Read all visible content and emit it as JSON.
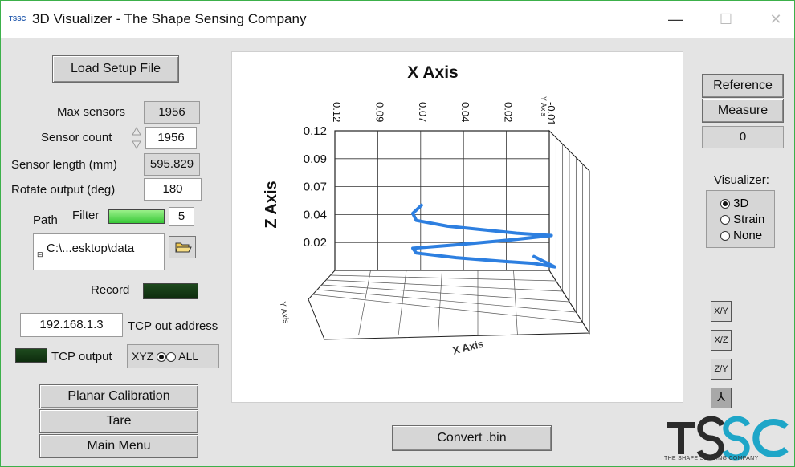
{
  "window": {
    "app_icon": "TSSC",
    "title": "3D Visualizer - The Shape Sensing Company",
    "minimize": "—",
    "maximize": "☐",
    "close": "✕"
  },
  "left": {
    "load_setup_label": "Load Setup File",
    "max_sensors_label": "Max sensors",
    "max_sensors_value": "1956",
    "sensor_count_label": "Sensor count",
    "sensor_count_value": "1956",
    "sensor_length_label": "Sensor length (mm)",
    "sensor_length_value": "595.829",
    "rotate_label": "Rotate output (deg)",
    "rotate_value": "180",
    "path_label": "Path",
    "filter_label": "Filter",
    "filter_value": "5",
    "path_value": "C:\\...esktop\\data",
    "record_label": "Record",
    "tcp_address_value": "192.168.1.3",
    "tcp_address_label": "TCP out address",
    "tcp_output_label": "TCP output",
    "xyz_label": "XYZ",
    "all_label": "ALL",
    "planar_calibration_label": "Planar Calibration",
    "tare_label": "Tare",
    "main_menu_label": "Main Menu"
  },
  "center": {
    "convert_label": "Convert .bin"
  },
  "right": {
    "reference_label": "Reference",
    "measure_label": "Measure",
    "measure_value": "0",
    "visualizer_label": "Visualizer:",
    "opt_3d": "3D",
    "opt_strain": "Strain",
    "opt_none": "None",
    "selected": "3D",
    "tool_icons": [
      "xy-plane-icon",
      "xz-plane-icon",
      "yz-plane-icon",
      "axes-3d-icon"
    ],
    "tool_xy": "X/Y",
    "tool_xz": "X/Z",
    "tool_yz": "Z/Y",
    "tool_3d": "⅄"
  },
  "logo": {
    "mark": "TSSC",
    "tagline": "THE SHAPE SENSING COMPANY"
  },
  "colors": {
    "accent_border": "#3cb04a",
    "led_on": "#5fe050",
    "led_off": "#163a16",
    "plot_line": "#2d7fe0",
    "logo_dark": "#2b2b2b",
    "logo_teal": "#1ea6c8"
  },
  "chart_data": {
    "type": "line",
    "title": "X Axis",
    "xlabel": "X Axis",
    "ylabel": "Y Axis",
    "zlabel": "Z Axis",
    "x_ticks": [
      "0.12",
      "0.09",
      "0.07",
      "0.04",
      "0.02",
      "-0.01"
    ],
    "z_ticks": [
      "0.12",
      "0.09",
      "0.07",
      "0.04",
      "0.02"
    ],
    "grid": true,
    "series": [
      {
        "points_xz": [
          [
            0.07,
            0.056
          ],
          [
            0.075,
            0.049
          ],
          [
            0.073,
            0.043
          ],
          [
            0.055,
            0.038
          ],
          [
            0.035,
            0.035
          ],
          [
            0.015,
            0.032
          ],
          [
            -0.005,
            0.03
          ],
          [
            0.02,
            0.026
          ],
          [
            0.05,
            0.022
          ],
          [
            0.075,
            0.019
          ],
          [
            0.073,
            0.015
          ],
          [
            0.05,
            0.011
          ],
          [
            0.025,
            0.008
          ],
          [
            0.005,
            0.006
          ],
          [
            -0.007,
            0.003
          ],
          [
            0.005,
            0.012
          ]
        ]
      }
    ]
  }
}
